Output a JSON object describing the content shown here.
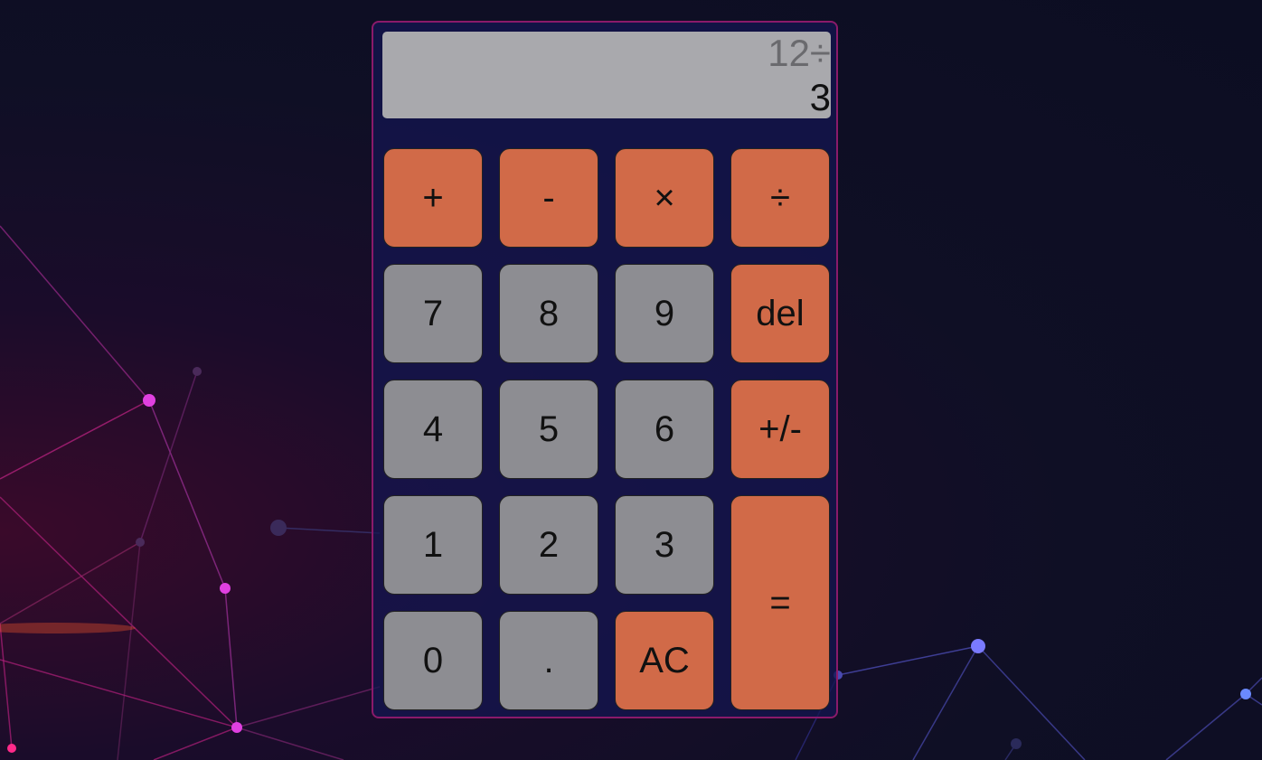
{
  "display": {
    "previous": "12÷",
    "current": "3"
  },
  "keys": {
    "add": "+",
    "subtract": "-",
    "multiply": "×",
    "divide": "÷",
    "seven": "7",
    "eight": "8",
    "nine": "9",
    "delete": "del",
    "four": "4",
    "five": "5",
    "six": "6",
    "sign": "+/-",
    "one": "1",
    "two": "2",
    "three": "3",
    "equals": "=",
    "zero": "0",
    "decimal": ".",
    "clear": "AC"
  },
  "colors": {
    "operator_key": "#d16a48",
    "number_key": "#8d8d92",
    "display_bg": "#a9a9ad",
    "frame_border": "#8a1a6a"
  }
}
